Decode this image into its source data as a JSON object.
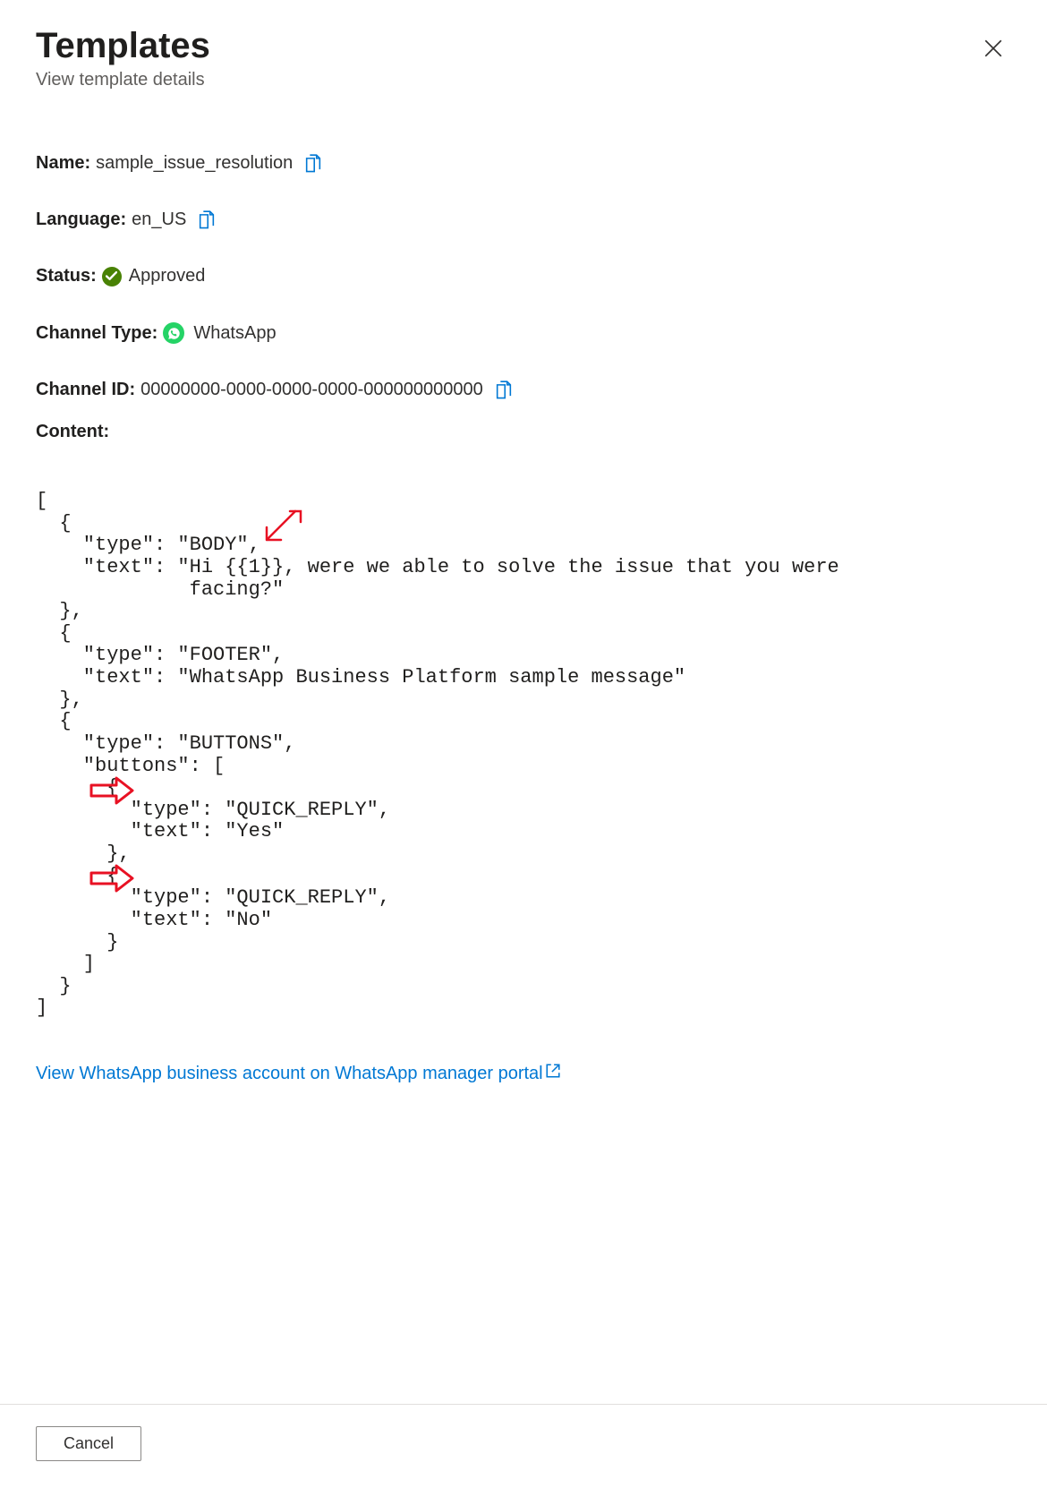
{
  "header": {
    "title": "Templates",
    "subtitle": "View template details"
  },
  "fields": {
    "name_label": "Name:",
    "name_value": "sample_issue_resolution",
    "language_label": "Language:",
    "language_value": "en_US",
    "status_label": "Status:",
    "status_value": "Approved",
    "channel_type_label": "Channel Type:",
    "channel_type_value": "WhatsApp",
    "channel_id_label": "Channel ID:",
    "channel_id_value": "00000000-0000-0000-0000-000000000000",
    "content_label": "Content:"
  },
  "code": "[\n  {\n    \"type\": \"BODY\",\n    \"text\": \"Hi {{1}}, were we able to solve the issue that you were\n             facing?\"\n  },\n  {\n    \"type\": \"FOOTER\",\n    \"text\": \"WhatsApp Business Platform sample message\"\n  },\n  {\n    \"type\": \"BUTTONS\",\n    \"buttons\": [\n      {\n        \"type\": \"QUICK_REPLY\",\n        \"text\": \"Yes\"\n      },\n      {\n        \"type\": \"QUICK_REPLY\",\n        \"text\": \"No\"\n      }\n    ]\n  }\n]",
  "link": {
    "text": "View WhatsApp business account on WhatsApp manager portal"
  },
  "footer": {
    "cancel": "Cancel"
  }
}
